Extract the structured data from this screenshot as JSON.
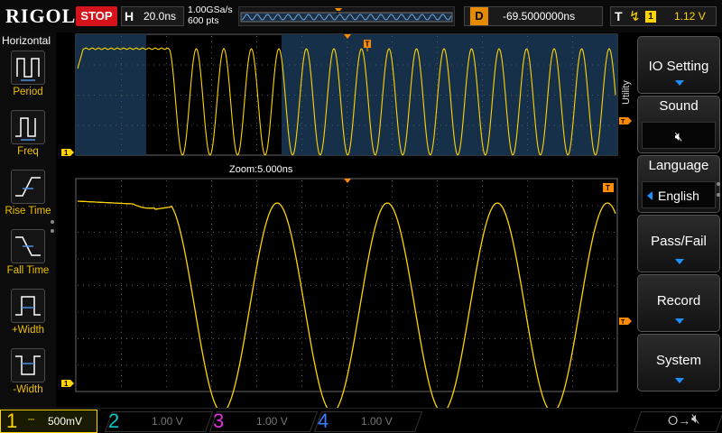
{
  "header": {
    "brand": "RIGOL",
    "run_state": "STOP",
    "timebase_label": "H",
    "timebase_value": "20.0ns",
    "sample_rate": "1.00GSa/s",
    "memory_depth": "600 pts",
    "delay_label": "D",
    "delay_value": "-69.5000000ns",
    "trigger_label": "T",
    "trigger_source": "1",
    "trigger_level": "1.12 V"
  },
  "left_panel": {
    "title": "Horizontal",
    "items": [
      {
        "label": "Period",
        "icon": "period-icon"
      },
      {
        "label": "Freq",
        "icon": "frequency-icon"
      },
      {
        "label": "Rise Time",
        "icon": "rise-time-icon"
      },
      {
        "label": "Fall Time",
        "icon": "fall-time-icon"
      },
      {
        "label": "+Width",
        "icon": "positive-width-icon"
      },
      {
        "label": "-Width",
        "icon": "negative-width-icon"
      }
    ]
  },
  "screen": {
    "zoom_label": "Zoom:5.000ns",
    "trigger_marker": "T",
    "channel_marker": "1"
  },
  "right_menu": {
    "tab_label": "Utility",
    "buttons": [
      {
        "label": "IO Setting"
      },
      {
        "label": "Sound",
        "icon": "speaker-muted-icon"
      },
      {
        "label": "Language",
        "value": "English"
      },
      {
        "label": "Pass/Fail"
      },
      {
        "label": "Record"
      },
      {
        "label": "System"
      }
    ]
  },
  "bottom_bar": {
    "channels": [
      {
        "number": "1",
        "scale": "500mV",
        "coupling": "⎓",
        "color": "#ffd400"
      },
      {
        "number": "2",
        "scale": "1.00 V",
        "color": "#00c8c8"
      },
      {
        "number": "3",
        "scale": "1.00 V",
        "color": "#e030e0"
      },
      {
        "number": "4",
        "scale": "1.00 V",
        "color": "#3a7bff"
      }
    ],
    "usb_icon": "usb-icon",
    "sound_icon": "speaker-muted-icon"
  },
  "colors": {
    "ch1": "#ffd400",
    "ch2": "#00c8c8",
    "ch3": "#e030e0",
    "ch4": "#3a7bff",
    "trigger": "#ff8c00",
    "menu_accent": "#1e90ff",
    "stop": "#d4131a"
  }
}
